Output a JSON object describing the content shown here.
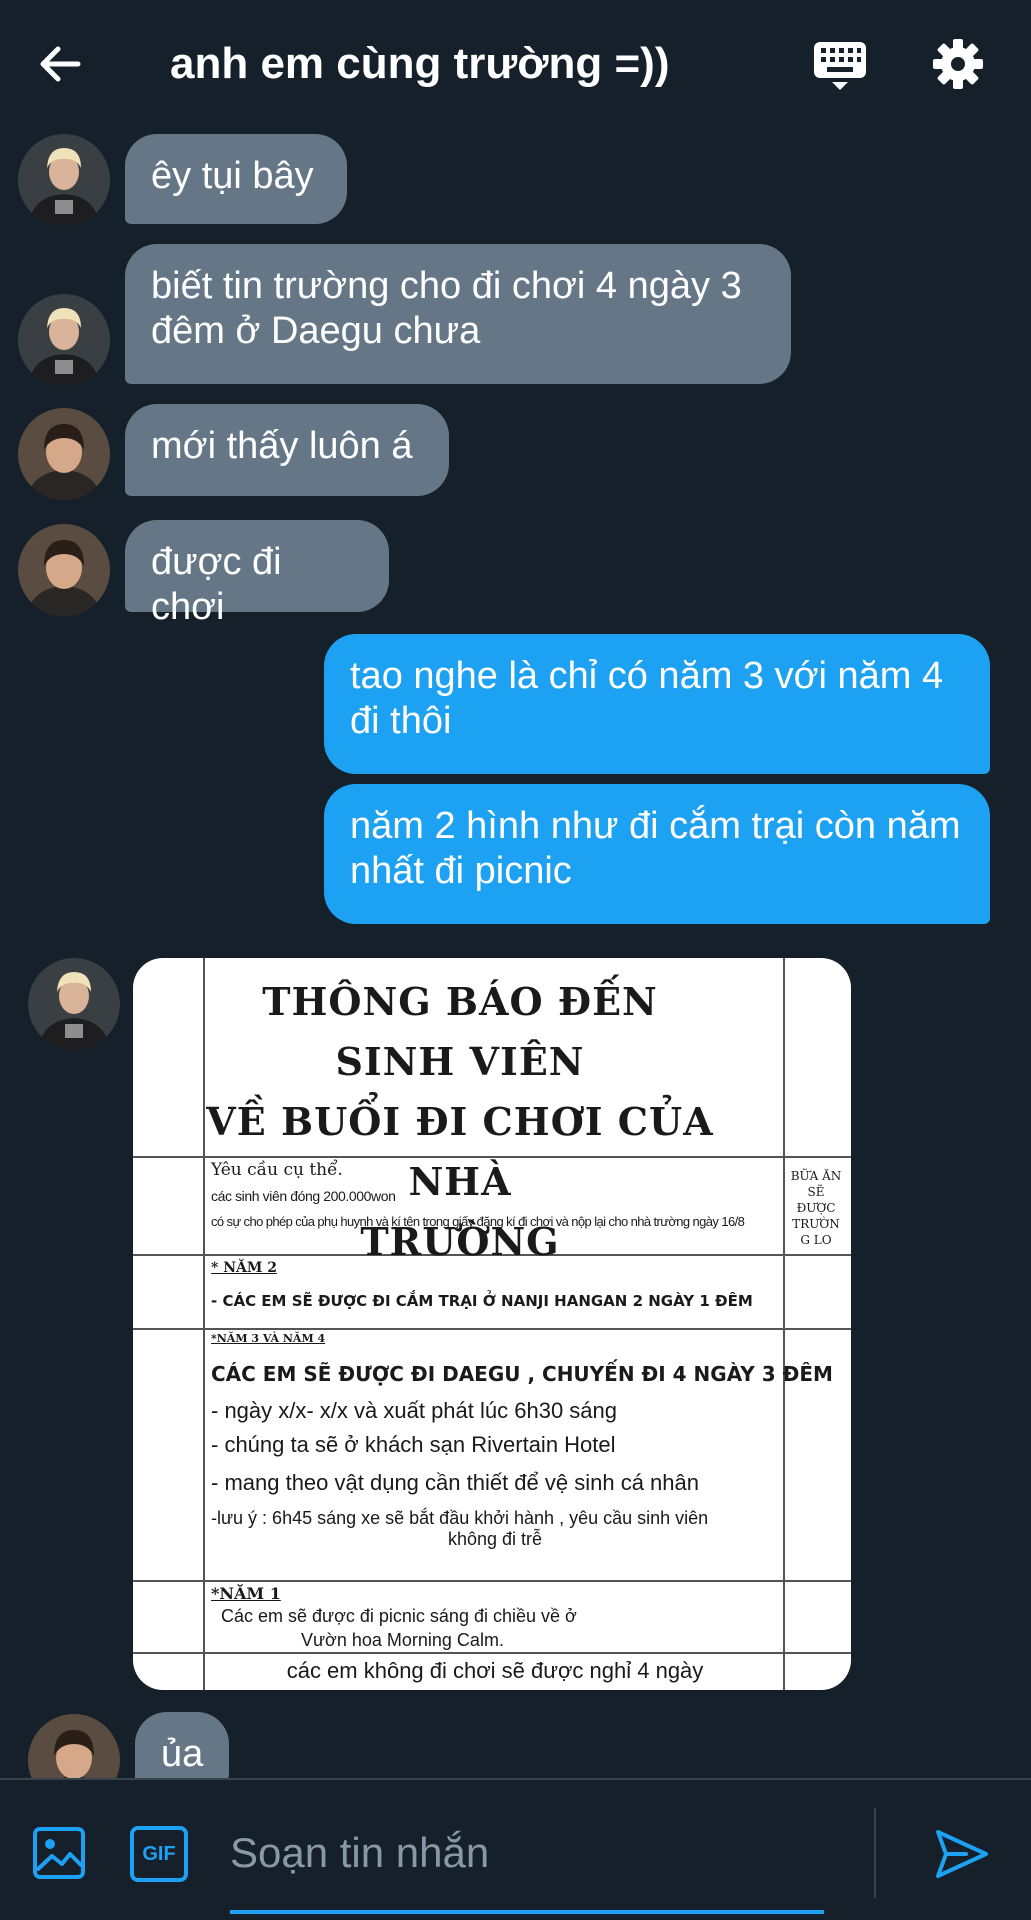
{
  "header": {
    "title": "anh em cùng trường =))",
    "back_icon": "arrow-left-icon",
    "keyboard_icon": "keyboard-icon",
    "settings_icon": "gear-icon"
  },
  "colors": {
    "background": "#15202b",
    "incoming_bubble": "#657786",
    "outgoing_bubble": "#1da1f2",
    "accent": "#1da1f2"
  },
  "messages": [
    {
      "from": "friend-1",
      "direction": "incoming",
      "text": "êy tụi bây"
    },
    {
      "from": "friend-1",
      "direction": "incoming",
      "text": "biết tin trường cho đi chơi 4 ngày 3 đêm ở Daegu chưa"
    },
    {
      "from": "friend-2",
      "direction": "incoming",
      "text": "mới thấy luôn á"
    },
    {
      "from": "friend-2",
      "direction": "incoming",
      "text": "được đi chơi"
    },
    {
      "from": "me",
      "direction": "outgoing",
      "text": "tao nghe là chỉ có năm 3 với năm 4 đi thôi"
    },
    {
      "from": "me",
      "direction": "outgoing",
      "text": "năm 2 hình như đi cắm trại còn năm nhất đi picnic"
    },
    {
      "from": "friend-1",
      "direction": "incoming",
      "type": "image",
      "text": ""
    },
    {
      "from": "friend-2",
      "direction": "incoming",
      "text": "ủa"
    }
  ],
  "notice": {
    "title_lines": [
      "THÔNG BÁO ĐẾN SINH VIÊN",
      "VỀ BUỔI ĐI CHƠI CỦA NHÀ",
      "TRƯỜNG"
    ],
    "side_note": [
      "BỮA ĂN",
      "SẼ",
      "ĐƯỢC",
      "TRƯỜN",
      "G LO"
    ],
    "requirements_heading": "Yêu cầu cụ thể.",
    "requirements": [
      "các sinh viên đóng 200.000won",
      "có sự cho phép của phụ huynh và kí tên trong giấy đăng kí đi chơi và nộp lại cho nhà trường ngày 16/8"
    ],
    "year2_heading": "* NĂM 2",
    "year2_text": "- CÁC EM SẼ ĐƯỢC ĐI CẮM TRẠI Ở NANJI HANGAN 2 NGÀY 1 ĐÊM",
    "year34_heading": "*NĂM 3 VÀ NĂM 4",
    "year34_title": "CÁC EM SẼ ĐƯỢC ĐI DAEGU , CHUYẾN ĐI 4 NGÀY 3 ĐÊM",
    "year34_items": [
      "- ngày x/x-  x/x và xuất phát lúc 6h30 sáng",
      "- chúng ta sẽ ở khách sạn  Rivertain Hotel",
      "- mang theo vật dụng cần thiết để vệ sinh cá nhân"
    ],
    "year34_note": [
      "-lưu ý : 6h45 sáng xe sẽ bắt đầu khởi hành , yêu cầu sinh viên",
      "không đi trễ"
    ],
    "year1_heading": "*NĂM 1",
    "year1_text": [
      "Các em sẽ được đi picnic sáng đi chiều về ở",
      "Vườn hoa Morning Calm."
    ],
    "footer": "các em không đi chơi sẽ được nghỉ 4 ngày"
  },
  "composer": {
    "placeholder": "Soạn tin nhắn",
    "image_icon": "image-icon",
    "gif_label": "GIF",
    "send_icon": "send-icon"
  }
}
